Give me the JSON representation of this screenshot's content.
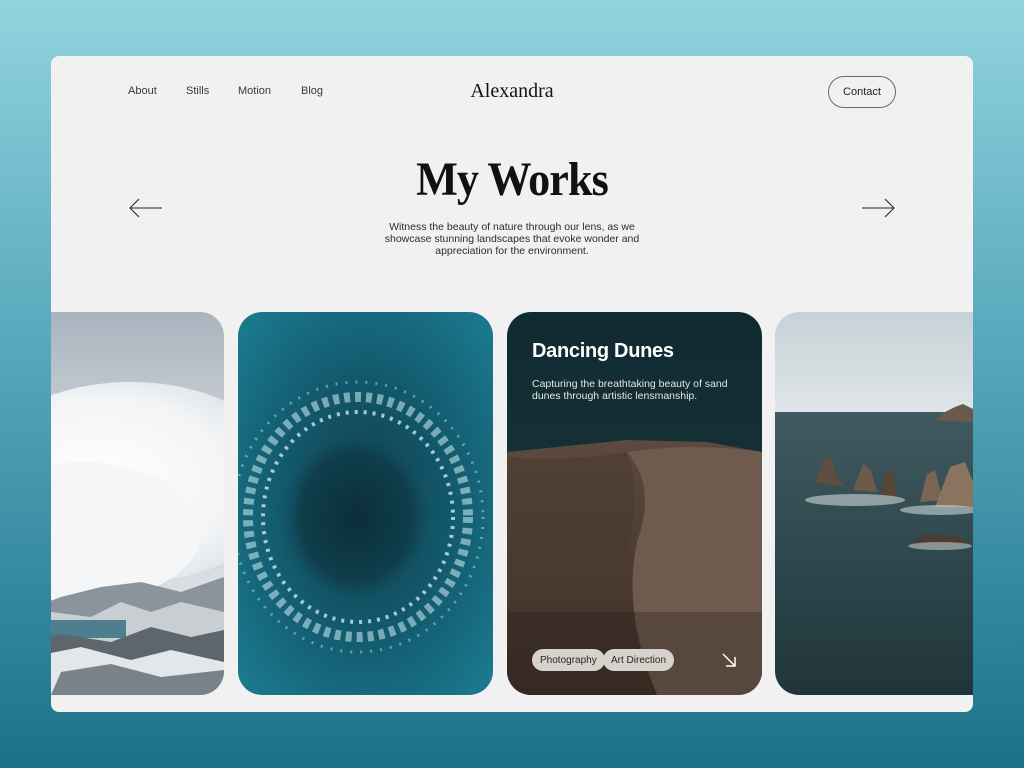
{
  "nav": {
    "items": [
      {
        "label": "About"
      },
      {
        "label": "Stills"
      },
      {
        "label": "Motion"
      },
      {
        "label": "Blog"
      }
    ],
    "brand": "Alexandra",
    "contact_label": "Contact"
  },
  "hero": {
    "title": "My Works",
    "subtitle": "Witness the beauty of nature through our lens, as we showcase stunning landscapes that evoke wonder and appreciation for the environment.",
    "prev_icon": "arrow-left-icon",
    "next_icon": "arrow-right-icon"
  },
  "cards": [
    {
      "image": "mountain-clouds-image"
    },
    {
      "image": "ocean-aerial-image"
    },
    {
      "image": "desert-dunes-image",
      "title": "Dancing Dunes",
      "description": "Capturing the breathtaking beauty of sand dunes through artistic lensmanship.",
      "tags": [
        "Photography",
        "Art Direction"
      ],
      "open_icon": "arrow-down-right-icon"
    },
    {
      "image": "sea-rocks-image"
    }
  ],
  "colors": {
    "page_bg_top": "#93d3df",
    "page_bg_bottom": "#1c7189",
    "frame_bg": "#f1f1f1",
    "text": "#111111",
    "tag_bg": "#d7d2cc"
  }
}
